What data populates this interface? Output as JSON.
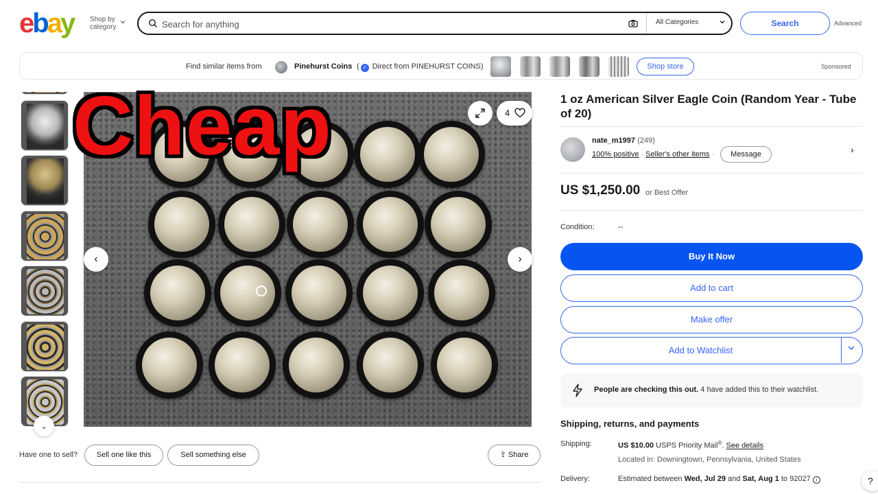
{
  "header": {
    "logo": {
      "e": "e",
      "b": "b",
      "a": "a",
      "y": "y"
    },
    "shop_by_line1": "Shop by",
    "shop_by_line2": "category",
    "search_placeholder": "Search for anything",
    "category": "All Categories",
    "search_label": "Search",
    "advanced_label": "Advanced"
  },
  "promo": {
    "find_text": "Find similar items from",
    "store_name": "Pinehurst Coins",
    "open_paren": "(",
    "direct_text": "Direct from PINEHURST COINS)",
    "shop_store_label": "Shop store",
    "sponsored_label": "Sponsored"
  },
  "gallery": {
    "watch_count": "4",
    "overlay_text": "Cheap",
    "thumbnail_count": 7
  },
  "sell": {
    "question": "Have one to sell?",
    "sell_like_label": "Sell one like this",
    "sell_else_label": "Sell something else",
    "share_label": "Share"
  },
  "listing": {
    "title": "1 oz American Silver Eagle Coin (Random Year - Tube of 20)",
    "seller": {
      "name": "nate_m1997",
      "feedback_count": "(249)",
      "positive": "100% positive",
      "other_items": "Seller's other items",
      "message_label": "Message"
    },
    "price": "US $1,250.00",
    "offer_text": "or Best Offer",
    "condition_label": "Condition:",
    "condition_value": "--",
    "buy_now_label": "Buy It Now",
    "add_cart_label": "Add to cart",
    "make_offer_label": "Make offer",
    "watchlist_label": "Add to Watchlist",
    "notice_bold": "People are checking this out.",
    "notice_rest": " 4 have added this to their watchlist."
  },
  "shipping": {
    "heading": "Shipping, returns, and payments",
    "shipping_label": "Shipping:",
    "shipping_price": "US $10.00",
    "shipping_service": " USPS Priority Mail",
    "reg_mark": "®",
    "see_details": "See details",
    "location": "Located in: Downingtown, Pennsylvania, United States",
    "delivery_label": "Delivery:",
    "delivery_prefix": "Estimated between ",
    "delivery_start": "Wed, Jul 29",
    "delivery_and": " and ",
    "delivery_end": "Sat, Aug 1",
    "delivery_suffix": " to 92027",
    "help": "?"
  },
  "colors": {
    "accent_blue": "#3665f3",
    "buy_now_blue": "#0654f1",
    "overlay_red": "#ee1111"
  }
}
